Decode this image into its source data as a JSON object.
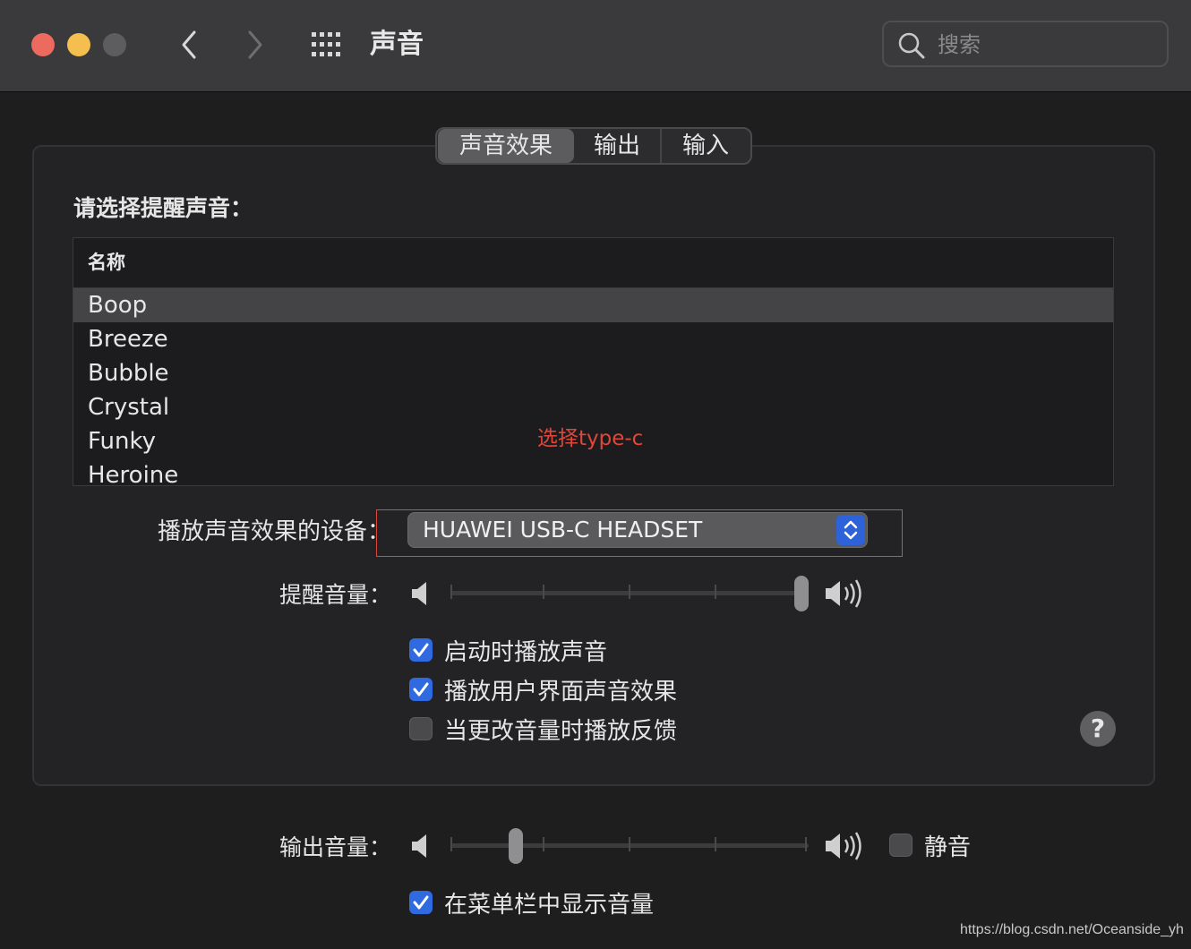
{
  "window": {
    "title": "声音",
    "search_placeholder": "搜索"
  },
  "tabs": [
    {
      "label": "声音效果",
      "active": true
    },
    {
      "label": "输出",
      "active": false
    },
    {
      "label": "输入",
      "active": false
    }
  ],
  "alert_section": {
    "label": "请选择提醒声音：",
    "table_header": "名称",
    "sounds": [
      "Boop",
      "Breeze",
      "Bubble",
      "Crystal",
      "Funky",
      "Heroine"
    ],
    "selected": "Boop"
  },
  "annotation": "选择type-c",
  "device": {
    "label": "播放声音效果的设备：",
    "value": "HUAWEI USB-C HEADSET"
  },
  "alert_volume": {
    "label": "提醒音量：",
    "level": 1.0
  },
  "checkboxes": [
    {
      "label": "启动时播放声音",
      "checked": true
    },
    {
      "label": "播放用户界面声音效果",
      "checked": true
    },
    {
      "label": "当更改音量时播放反馈",
      "checked": false
    }
  ],
  "help": "?",
  "output_volume": {
    "label": "输出音量：",
    "level": 0.17,
    "mute_label": "静音",
    "mute_checked": false
  },
  "menubar_checkbox": {
    "label": "在菜单栏中显示音量",
    "checked": true
  },
  "watermark": "https://blog.csdn.net/Oceanside_yh",
  "colors": {
    "accent": "#2f6ae0",
    "annotation": "#e0463a"
  }
}
